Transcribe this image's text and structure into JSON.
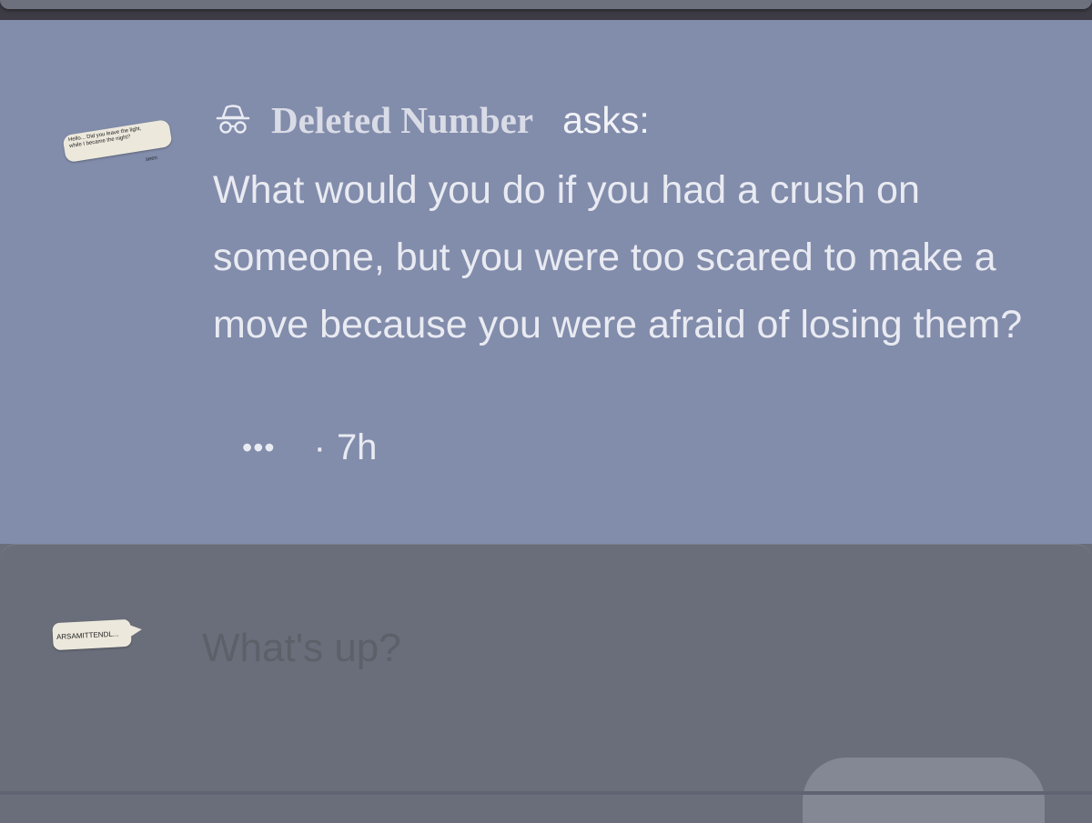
{
  "ask": {
    "avatar_text": "Hello... Did you leave the light,\nwhile I became the night?",
    "avatar_seen": "seen",
    "asker_name": "Deleted Number",
    "asks_label": "asks:",
    "question": "What would you do if you had a crush on someone, but you were too scared to make a move because you were afraid of losing them?",
    "more_label": "•••",
    "separator": "·",
    "time": "7h",
    "icon": "incognito-icon"
  },
  "compose": {
    "avatar_text": "ARSAMITTENDL...",
    "placeholder": "What's up?"
  },
  "colors": {
    "card_background": "#828cab",
    "compose_background": "#6a6e7b",
    "text": "#e9ebf2"
  }
}
